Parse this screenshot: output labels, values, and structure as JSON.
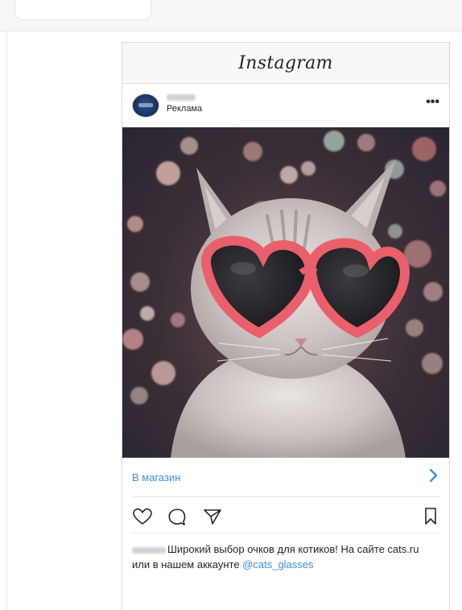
{
  "instagram": {
    "logo_text": "Instagram"
  },
  "post": {
    "account_name": "",
    "sponsored_label": "Реклама",
    "more_icon": "more-dots-icon",
    "cta_label": "В магазин",
    "cta_icon": "chevron-right-icon",
    "actions": [
      "heart-icon",
      "comment-icon",
      "share-icon",
      "bookmark-icon"
    ],
    "caption_text": "Широкий выбор очков для котиков! На сайте cats.ru или в нашем аккаунте ",
    "caption_mention": "@cats_glasses"
  },
  "colors": {
    "link_blue": "#3f8ddf",
    "glasses_pink": "#e9606a",
    "text_dark": "#262626"
  }
}
